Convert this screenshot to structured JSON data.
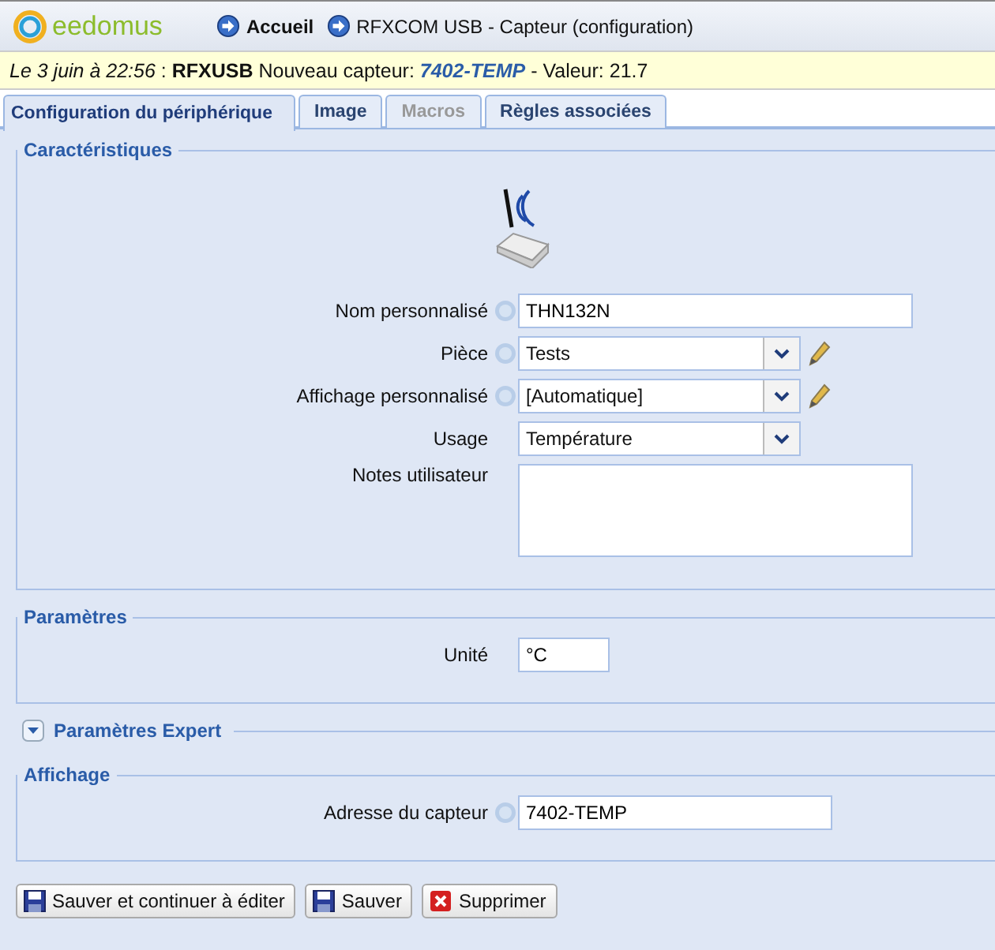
{
  "header": {
    "logo": "eedomus",
    "breadcrumbs": [
      {
        "label": "Accueil",
        "bold": true
      },
      {
        "label": "RFXCOM USB - Capteur (configuration)",
        "bold": false
      }
    ]
  },
  "notice": [
    {
      "text": "Le 3 juin à 22:56",
      "kind": "date"
    },
    {
      "text": " : ",
      "kind": "plain"
    },
    {
      "text": "RFXUSB",
      "kind": "source"
    },
    {
      "text": " Nouveau capteur: ",
      "kind": "plain"
    },
    {
      "text": "7402-TEMP",
      "kind": "device"
    },
    {
      "text": " - Valeur: 21.7",
      "kind": "plain"
    }
  ],
  "tabs": [
    {
      "label": "Configuration du périphérique",
      "selected": true,
      "disabled": false
    },
    {
      "label": "Image",
      "selected": false,
      "disabled": false
    },
    {
      "label": "Macros",
      "selected": false,
      "disabled": true
    },
    {
      "label": "Règles associées",
      "selected": false,
      "disabled": false
    }
  ],
  "sections": [
    {
      "title": "Caractéristiques",
      "device_image": true,
      "fields": [
        {
          "label": "Nom personnalisé",
          "kind": "text",
          "help": true,
          "editable": false,
          "value": "THN132N"
        },
        {
          "label": "Pièce",
          "kind": "select",
          "help": true,
          "editable": true,
          "value": "Tests"
        },
        {
          "label": "Affichage personnalisé",
          "kind": "select",
          "help": true,
          "editable": true,
          "value": "[Automatique]"
        },
        {
          "label": "Usage",
          "kind": "select",
          "help": false,
          "editable": false,
          "value": "Température"
        },
        {
          "label": "Notes utilisateur",
          "kind": "textarea",
          "help": false,
          "editable": false
        }
      ]
    },
    {
      "title": "Paramètres",
      "device_image": false,
      "fields": [
        {
          "label": "Unité",
          "kind": "short",
          "help": false,
          "editable": false,
          "value": "°C"
        }
      ]
    },
    {
      "title": "Paramètres Expert",
      "collapsible": true,
      "expanded": false
    },
    {
      "title": "Affichage",
      "device_image": false,
      "fields": [
        {
          "label": "Adresse du capteur",
          "kind": "medium",
          "help": true,
          "editable": false,
          "value": "7402-TEMP"
        }
      ]
    }
  ],
  "buttons": [
    {
      "label": "Sauver et continuer à éditer",
      "kind": "save"
    },
    {
      "label": "Sauver",
      "kind": "save"
    },
    {
      "label": "Supprimer",
      "kind": "delete"
    }
  ]
}
